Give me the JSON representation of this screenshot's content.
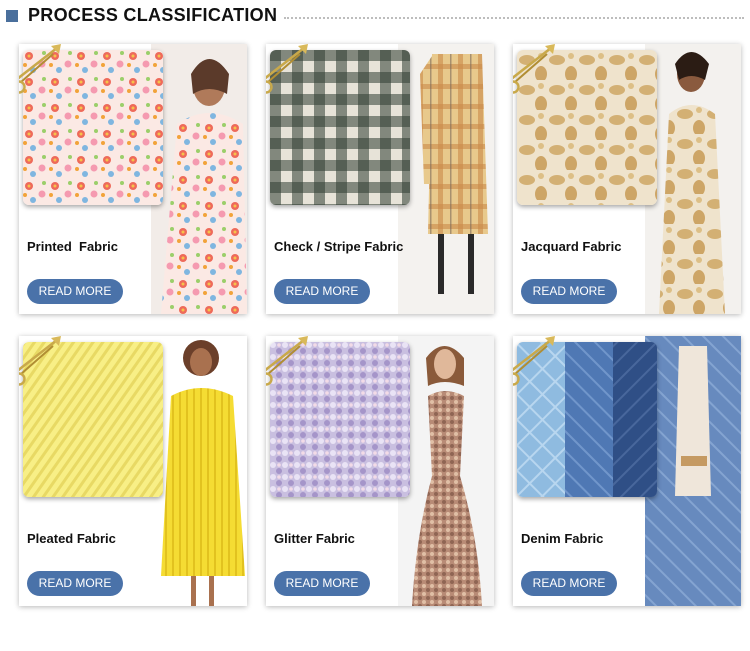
{
  "header": {
    "title": "PROCESS CLASSIFICATION"
  },
  "cards": [
    {
      "label": "Printed  Fabric",
      "button": "READ MORE"
    },
    {
      "label": "Check / Stripe Fabric",
      "button": "READ MORE"
    },
    {
      "label": "Jacquard Fabric",
      "button": "READ MORE"
    },
    {
      "label": "Pleated Fabric",
      "button": "READ MORE"
    },
    {
      "label": "Glitter Fabric",
      "button": "READ MORE"
    },
    {
      "label": "Denim Fabric",
      "button": "READ MORE"
    }
  ],
  "colors": {
    "accent": "#4a6f9c",
    "button": "#4a72a9",
    "pin": "#c9a94a"
  }
}
